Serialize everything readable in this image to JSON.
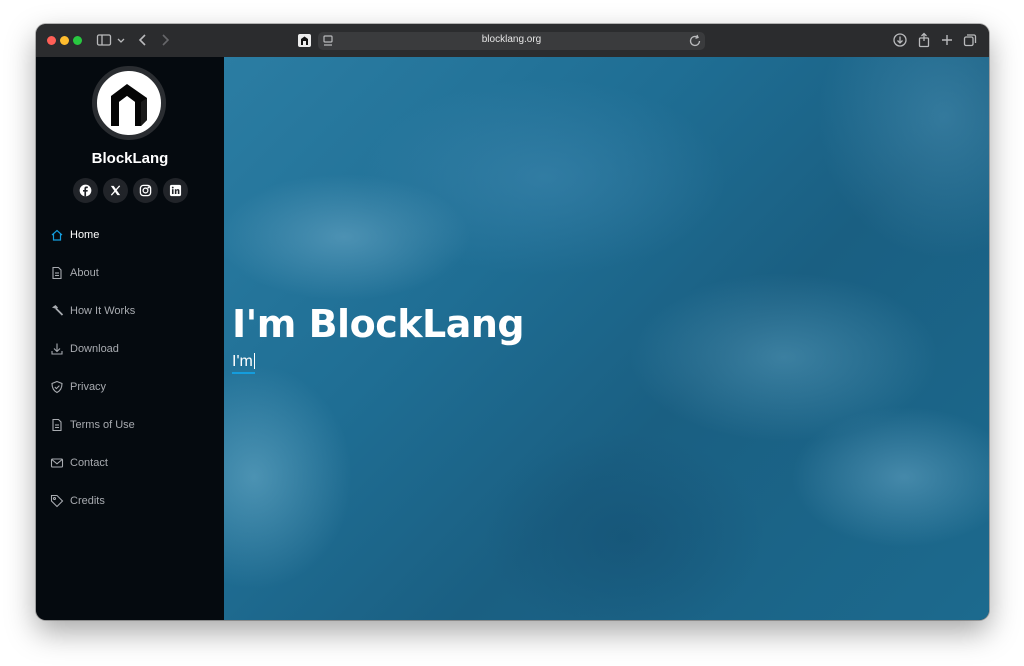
{
  "browser": {
    "url": "blocklang.org",
    "icons": {
      "sidebar_toggle": "sidebar-icon",
      "back": "chevron-left-icon",
      "forward": "chevron-right-icon",
      "reload": "reload-icon",
      "download": "download-icon",
      "share": "share-icon",
      "new_tab": "plus-icon",
      "tabs": "tabs-icon"
    }
  },
  "sidebar": {
    "site_name": "BlockLang",
    "socials": [
      "facebook",
      "x",
      "instagram",
      "linkedin"
    ],
    "nav": [
      {
        "label": "Home",
        "icon": "house-icon",
        "active": true
      },
      {
        "label": "About",
        "icon": "file-icon",
        "active": false
      },
      {
        "label": "How It Works",
        "icon": "hammer-icon",
        "active": false
      },
      {
        "label": "Download",
        "icon": "download-icon",
        "active": false
      },
      {
        "label": "Privacy",
        "icon": "shield-icon",
        "active": false
      },
      {
        "label": "Terms of Use",
        "icon": "file-icon",
        "active": false
      },
      {
        "label": "Contact",
        "icon": "envelope-icon",
        "active": false
      },
      {
        "label": "Credits",
        "icon": "tag-icon",
        "active": false
      }
    ]
  },
  "hero": {
    "title": "I'm BlockLang",
    "typed": "I'm"
  },
  "colors": {
    "sidebar_bg": "#050a0f",
    "accent": "#149ddd",
    "hero_bg": "#1f6e94"
  }
}
